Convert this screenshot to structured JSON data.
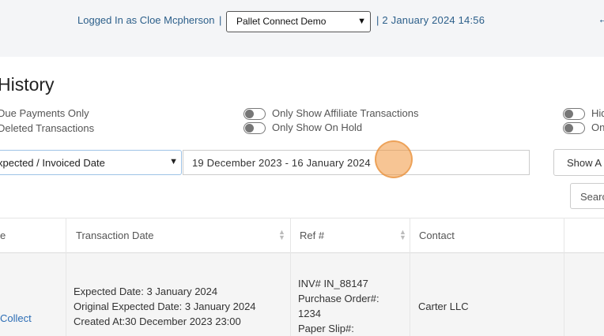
{
  "header": {
    "logged_in_text": "Logged In as Cloe Mcpherson",
    "separator": "|",
    "account_selected": "Pallet Connect Demo",
    "datetime_text": "| 2 January 2024 14:56"
  },
  "page": {
    "title": "History",
    "options_left": [
      "Due Payments Only",
      "Deleted Transactions"
    ],
    "options_middle": [
      "Only Show Affiliate Transactions",
      "Only Show On Hold"
    ],
    "options_right": [
      "Hid",
      "On"
    ],
    "date_type_selected": "xpected / Invoiced Date",
    "date_range_value": "19 December 2023 - 16 January 2024",
    "show_button_label": "Show A",
    "search_placeholder": "Searc"
  },
  "table": {
    "columns": [
      "e",
      "Transaction Date",
      "Ref #",
      "Contact"
    ],
    "rows": [
      {
        "type_link": "Collect",
        "transaction_date_lines": [
          "Expected Date: 3 January 2024",
          "Original Expected Date: 3 January 2024",
          "Created At:30 December 2023 23:00"
        ],
        "ref_lines": [
          "INV# IN_88147",
          "Purchase Order#:",
          "1234",
          "Paper Slip#:"
        ],
        "contact": "Carter LLC"
      }
    ]
  },
  "icons": {
    "select_chevron": "chevron-down-icon",
    "sort": "sort-icon",
    "toggle": "toggle-switch-icon"
  },
  "colors": {
    "link_blue": "#2c5f8a",
    "accent_blue": "#2c6db5",
    "click_marker": "#f0963c"
  }
}
